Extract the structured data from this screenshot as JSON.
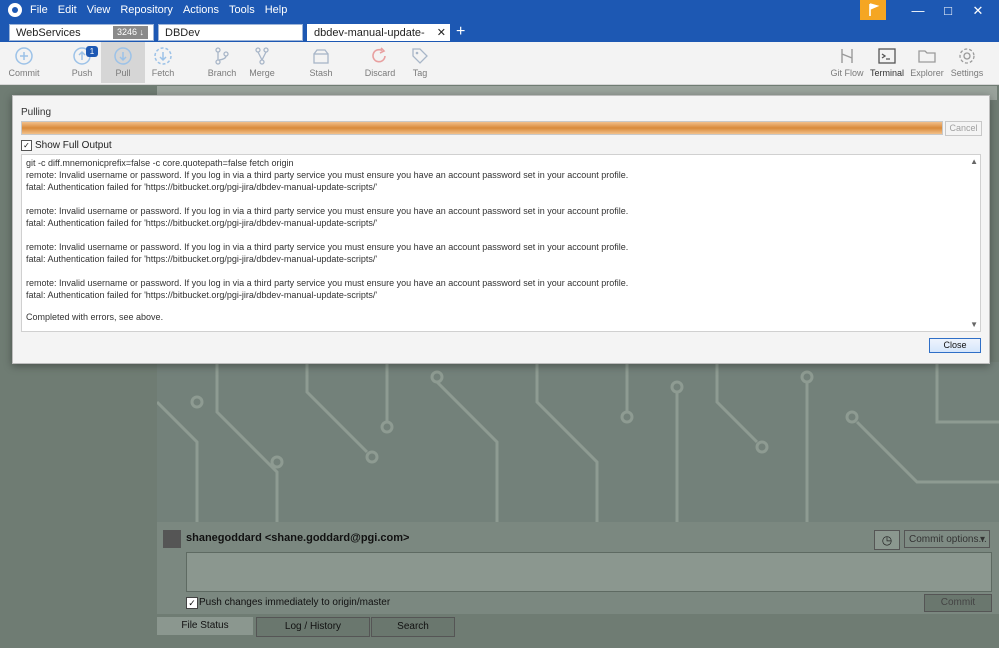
{
  "menu": [
    "File",
    "Edit",
    "View",
    "Repository",
    "Actions",
    "Tools",
    "Help"
  ],
  "tabs": [
    {
      "label": "WebServices",
      "badge": "3246 ↓"
    },
    {
      "label": "DBDev"
    },
    {
      "label": "dbdev-manual-update-scri..."
    }
  ],
  "new_tab": "+",
  "toolbar": {
    "left": [
      {
        "label": "Commit"
      },
      {
        "label": "Push",
        "badge": "1"
      },
      {
        "label": "Pull"
      },
      {
        "label": "Fetch"
      },
      {
        "label": "Branch"
      },
      {
        "label": "Merge"
      },
      {
        "label": "Stash"
      },
      {
        "label": "Discard"
      },
      {
        "label": "Tag"
      }
    ],
    "right": [
      {
        "label": "Git Flow"
      },
      {
        "label": "Terminal"
      },
      {
        "label": "Explorer"
      },
      {
        "label": "Settings"
      }
    ]
  },
  "dialog": {
    "title": "Pulling",
    "cancel": "Cancel",
    "show_full_output": "Show Full Output",
    "output_lines": [
      "git -c diff.mnemonicprefix=false -c core.quotepath=false fetch origin",
      "remote: Invalid username or password. If you log in via a third party service you must ensure you have an account password set in your account profile.",
      "fatal: Authentication failed for 'https://bitbucket.org/pgi-jira/dbdev-manual-update-scripts/'",
      "",
      "remote: Invalid username or password. If you log in via a third party service you must ensure you have an account password set in your account profile.",
      "fatal: Authentication failed for 'https://bitbucket.org/pgi-jira/dbdev-manual-update-scripts/'",
      "",
      "remote: Invalid username or password. If you log in via a third party service you must ensure you have an account password set in your account profile.",
      "fatal: Authentication failed for 'https://bitbucket.org/pgi-jira/dbdev-manual-update-scripts/'",
      "",
      "remote: Invalid username or password. If you log in via a third party service you must ensure you have an account password set in your account profile.",
      "fatal: Authentication failed for 'https://bitbucket.org/pgi-jira/dbdev-manual-update-scripts/'",
      "",
      "Completed with errors, see above."
    ],
    "close": "Close"
  },
  "commit": {
    "author": "shanegoddard <shane.goddard@pgi.com>",
    "options": "Commit options...",
    "push_label": "Push changes immediately to origin/master",
    "commit_button": "Commit"
  },
  "bottom_tabs": [
    "File Status",
    "Log / History",
    "Search"
  ],
  "colors": {
    "titlebar": "#1d58b3",
    "accent": "#f5a623",
    "progress": "#d98a3a",
    "overlay": "#6f7c73"
  }
}
